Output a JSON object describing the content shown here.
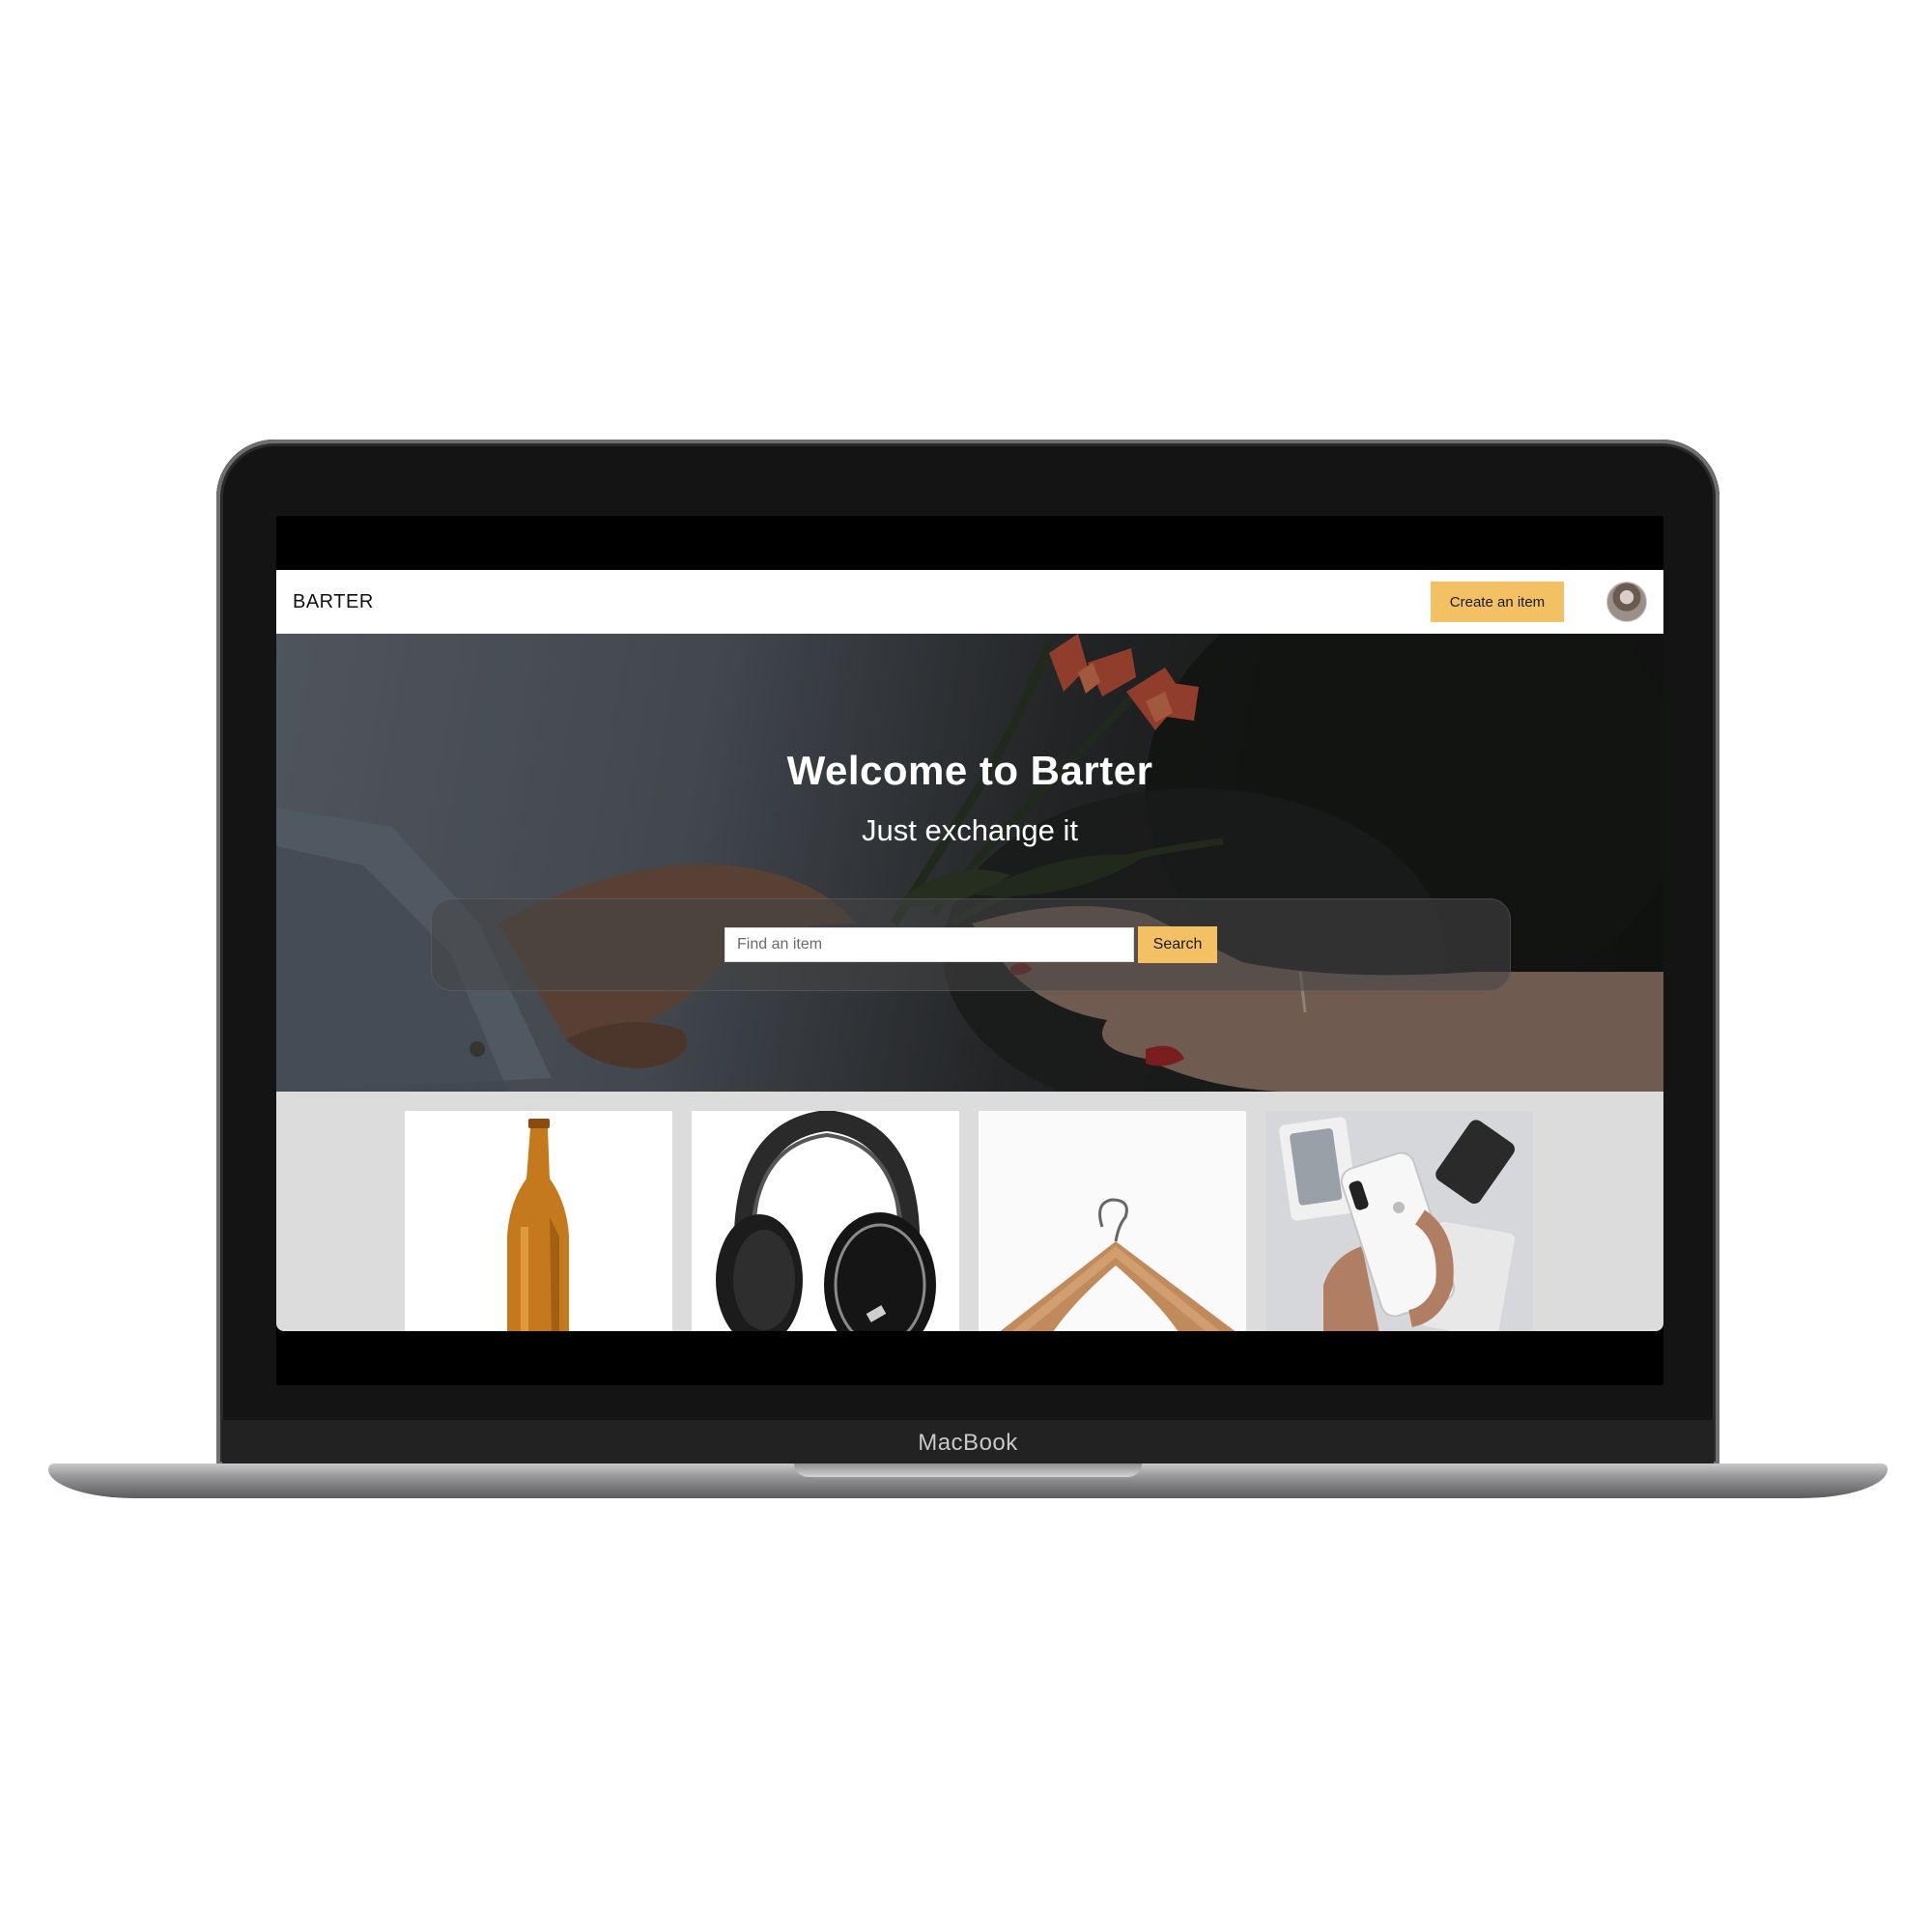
{
  "device": {
    "brand": "MacBook"
  },
  "navbar": {
    "logo": "BARTER",
    "create_label": "Create an item",
    "avatar_icon": "user-avatar-icon"
  },
  "hero": {
    "title": "Welcome to Barter",
    "subtitle": "Just exchange it",
    "search_placeholder": "Find an item",
    "search_value": "",
    "search_label": "Search"
  },
  "items": [
    {
      "icon": "beer-bottle-icon"
    },
    {
      "icon": "headphones-icon"
    },
    {
      "icon": "clothes-hanger-icon"
    },
    {
      "icon": "smartphone-icon"
    }
  ],
  "colors": {
    "accent": "#f4c064",
    "grid_background": "#dcdcdc",
    "navbar_background": "#ffffff"
  }
}
